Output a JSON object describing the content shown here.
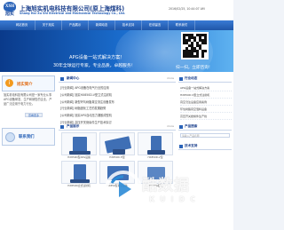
{
  "header": {
    "logo_mark": "XSH",
    "logo_text": "旭实",
    "company_name_zh": "上海旭实机电科技有限公司(原上海煤科)",
    "company_name_en": "Shang Hai Xu Shi Electrical and Mechanical Technology Co., Ltd.",
    "date_text": "2016/02/25, 10:44:07 AM"
  },
  "nav": {
    "items": [
      "网站首页",
      "关于旭实",
      "产品展示",
      "新闻动态",
      "技术支持",
      "在线留言",
      "联系我们"
    ]
  },
  "banner": {
    "line1": "APG设备一站式解决方案！",
    "line2": "30年全球运行专家，专业品质，卓越服务！",
    "qr_caption": "扫一扫，立即咨询！"
  },
  "left": {
    "about_title": "旭实简介",
    "about_text": "旭实机电科技有限公司是一家专业从事APG设备研发、生产和销售的企业，产品广泛应用于电力行业。",
    "more_label": "查看更多",
    "contact_title": "联系我们"
  },
  "news": {
    "title": "新闻中心",
    "more": "more",
    "items": [
      "[行业新闻] APG设备在电气行业的应用",
      "[公司新闻] 旭实HX850D-V型立式注射机",
      "[公司新闻] 新型环氧树脂真空浇注设备发布",
      "[行业新闻] 树脂固化工艺的发展趋势",
      "[公司新闻] 旭实APG自动压力凝胶成型机",
      "[行业新闻] 高压开关绝缘件生产技术探讨"
    ]
  },
  "products": {
    "title": "产品展示",
    "more": "more",
    "items": [
      {
        "caption": "HX850D型APG设备"
      },
      {
        "caption": "HX850D-H型"
      },
      {
        "caption": "HX850D-V型"
      },
      {
        "caption": "HX850D立式注射机"
      },
      {
        "caption": "HX850型真空设备"
      },
      {
        "caption": "HX-APG模具"
      }
    ]
  },
  "right": {
    "services_title": "行业动态",
    "services": [
      "APG设备一站式解决方案",
      "HX850D-V型立式注射机",
      "真空浇注设备应用案例",
      "环氧树脂真空混料设备",
      "高压开关绝缘件生产线"
    ],
    "search_title": "产品搜索",
    "search_placeholder": "请输入产品名称",
    "tech_title": "技术支持"
  },
  "watermark": {
    "text": "酷数据",
    "sub": "KUIDC"
  },
  "colors": {
    "brand_blue": "#1a3f8c",
    "nav_blue": "#2a63b8",
    "accent_orange": "#e2701a"
  }
}
